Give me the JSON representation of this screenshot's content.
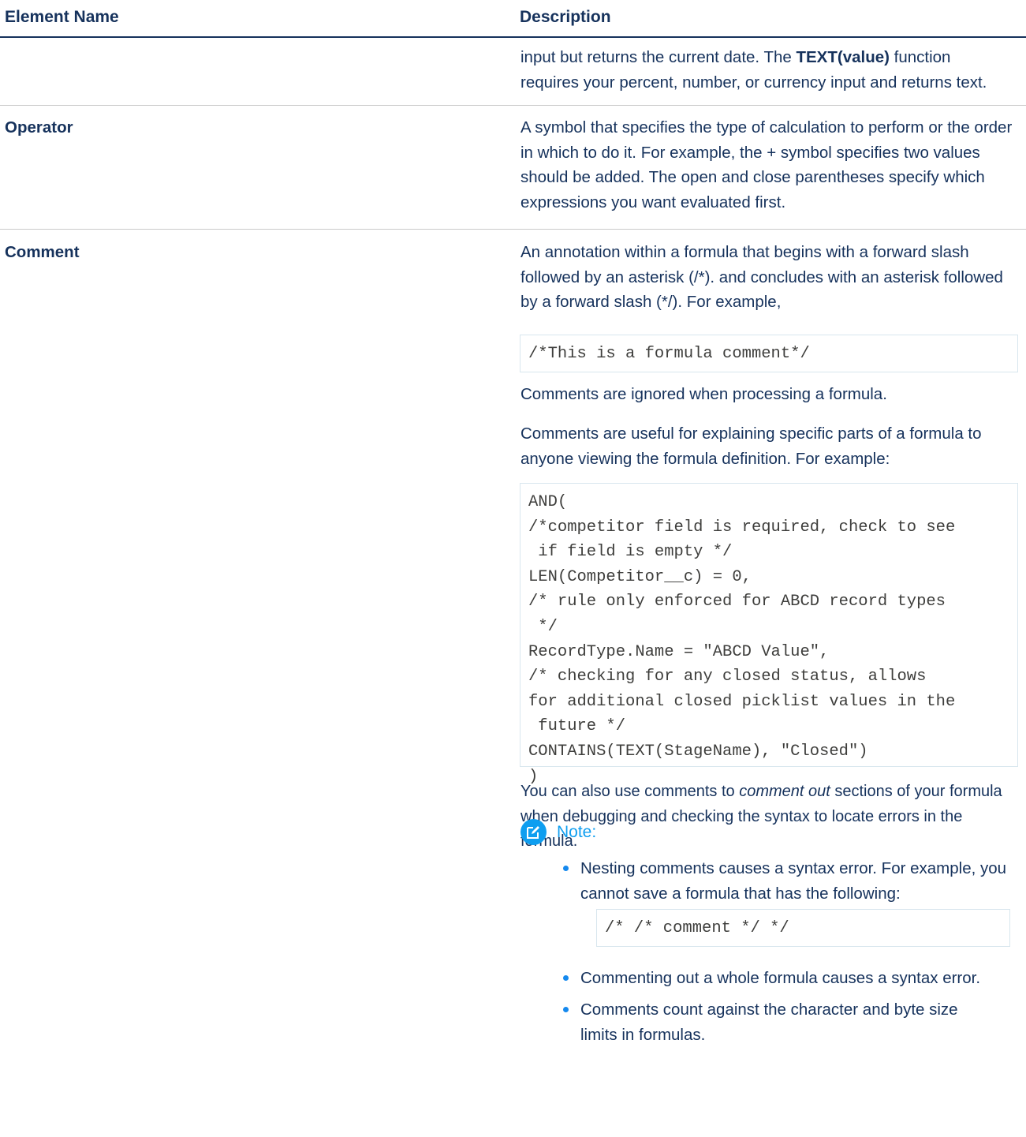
{
  "header": {
    "element_name": "Element Name",
    "description": "Description"
  },
  "row_function": {
    "line1_pre": "input but returns the current date. The ",
    "line1_bold": "TEXT(value)",
    "line1_post": " function",
    "line2": "requires your percent, number, or currency input and returns text."
  },
  "row_operator": {
    "name": "Operator",
    "description": "A symbol that specifies the type of calculation to perform or the order in which to do it. For example, the + symbol specifies two values should be added. The open and close parentheses specify which expressions you want evaluated first."
  },
  "row_comment": {
    "name": "Comment",
    "intro": "An annotation within a formula that begins with a forward slash followed by an asterisk (/*). and concludes with an asterisk followed by a forward slash (*/). For example,",
    "code1": "/*This is a formula comment*/",
    "ignored": "Comments are ignored when processing a formula.",
    "useful": "Comments are useful for explaining specific parts of a formula to anyone viewing the formula definition. For example:",
    "code2": "AND(\n/*competitor field is required, check to see\n if field is empty */\nLEN(Competitor__c) = 0,\n/* rule only enforced for ABCD record types\n */\nRecordType.Name = \"ABCD Value\",\n/* checking for any closed status, allows\nfor additional closed picklist values in the\n future */\nCONTAINS(TEXT(StageName), \"Closed\")\n)",
    "also_pre": "You can also use comments to ",
    "also_italic": "comment out",
    "also_post": " sections of your formula when debugging and checking the syntax to locate errors in the formula.",
    "note": {
      "icon": "edit-note-icon",
      "title": "Note:",
      "bullet1": "Nesting comments causes a syntax error. For example, you cannot save a formula that has the following:",
      "code3": "/* /* comment */ */",
      "bullet2": "Commenting out a whole formula causes a syntax error.",
      "bullet3": "Comments count against the character and byte size limits in formulas."
    }
  },
  "colors": {
    "text": "#16325c",
    "accent": "#0e9ef0",
    "code_border": "#d8e6ee"
  }
}
